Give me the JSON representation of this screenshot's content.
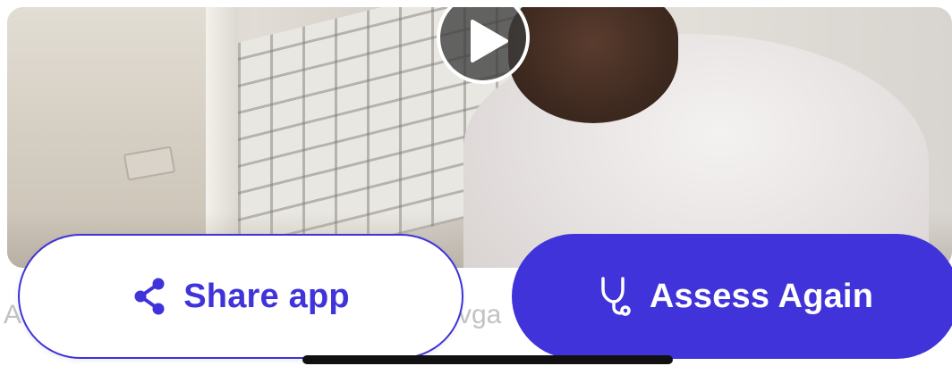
{
  "video": {
    "play_icon": "play-icon"
  },
  "background_text": {
    "left_fragment": "A",
    "middle_fragment": "vga"
  },
  "actions": {
    "share_label": "Share app",
    "share_icon": "share-icon",
    "assess_label": "Assess Again",
    "assess_icon": "stethoscope-icon"
  },
  "colors": {
    "accent": "#3f33d9",
    "accent_text_on": "#ffffff"
  }
}
